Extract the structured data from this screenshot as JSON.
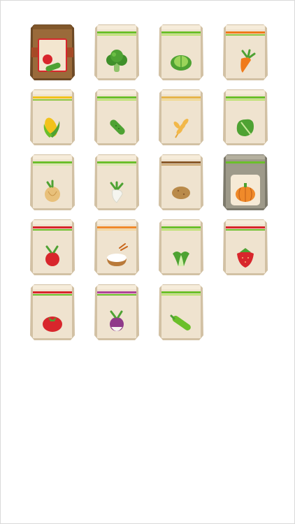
{
  "packets": [
    {
      "icon": "tomato-cucumber-icon",
      "style": "kraft",
      "band": [
        "#7a3b1e",
        "#a54a26"
      ],
      "label": "mixed-vegetable-seeds"
    },
    {
      "icon": "broccoli-icon",
      "style": "plain",
      "band": [
        "#6bbf2a",
        "#b9e26a"
      ],
      "label": "broccoli-seeds"
    },
    {
      "icon": "cabbage-icon",
      "style": "plain",
      "band": [
        "#6bbf2a",
        "#b9e26a"
      ],
      "label": "cabbage-seeds"
    },
    {
      "icon": "carrot-icon",
      "style": "plain",
      "band": [
        "#f07a1a",
        "#8cc63f"
      ],
      "label": "carrot-seeds"
    },
    {
      "icon": "corn-icon",
      "style": "plain",
      "band": [
        "#f2c21b",
        "#8cc63f"
      ],
      "label": "corn-seeds"
    },
    {
      "icon": "cucumber-icon",
      "style": "plain",
      "band": [
        "#6bbf2a",
        "#b9e26a"
      ],
      "label": "cucumber-seeds"
    },
    {
      "icon": "wheat-icon",
      "style": "plain",
      "band": [
        "#e6b54a",
        "#f1d88c"
      ],
      "label": "wheat-seeds"
    },
    {
      "icon": "lettuce-icon",
      "style": "plain",
      "band": [
        "#6bbf2a",
        "#b9e26a"
      ],
      "label": "lettuce-seeds"
    },
    {
      "icon": "onion-icon",
      "style": "plain",
      "band": [
        "#6bbf2a",
        "#d7e9a8"
      ],
      "label": "onion-seeds"
    },
    {
      "icon": "white-radish-icon",
      "style": "plain",
      "band": [
        "#6bbf2a",
        "#d7e9a8"
      ],
      "label": "white-radish-seeds"
    },
    {
      "icon": "potato-icon",
      "style": "plain",
      "band": [
        "#8a5a2b",
        "#caa36a"
      ],
      "label": "potato-seeds"
    },
    {
      "icon": "pumpkin-icon",
      "style": "gray",
      "band": [
        "#6bbf2a",
        "#9a9a88"
      ],
      "label": "pumpkin-seeds"
    },
    {
      "icon": "radish-icon",
      "style": "plain",
      "band": [
        "#d8262c",
        "#6bbf2a"
      ],
      "label": "radish-seeds"
    },
    {
      "icon": "rice-bowl-icon",
      "style": "plain",
      "band": [
        "#f08a2a",
        "#f5d59a"
      ],
      "label": "rice-seeds"
    },
    {
      "icon": "bok-choy-icon",
      "style": "plain",
      "band": [
        "#6bbf2a",
        "#b9e26a"
      ],
      "label": "bok-choy-seeds"
    },
    {
      "icon": "strawberry-icon",
      "style": "plain",
      "band": [
        "#d8262c",
        "#6bbf2a"
      ],
      "label": "strawberry-seeds"
    },
    {
      "icon": "tomato-icon",
      "style": "plain",
      "band": [
        "#d8262c",
        "#6bbf2a"
      ],
      "label": "tomato-seeds"
    },
    {
      "icon": "turnip-icon",
      "style": "plain",
      "band": [
        "#b0459a",
        "#6bbf2a"
      ],
      "label": "turnip-seeds"
    },
    {
      "icon": "zucchini-icon",
      "style": "plain",
      "band": [
        "#6bbf2a",
        "#b9e26a"
      ],
      "label": "zucchini-seeds"
    }
  ]
}
